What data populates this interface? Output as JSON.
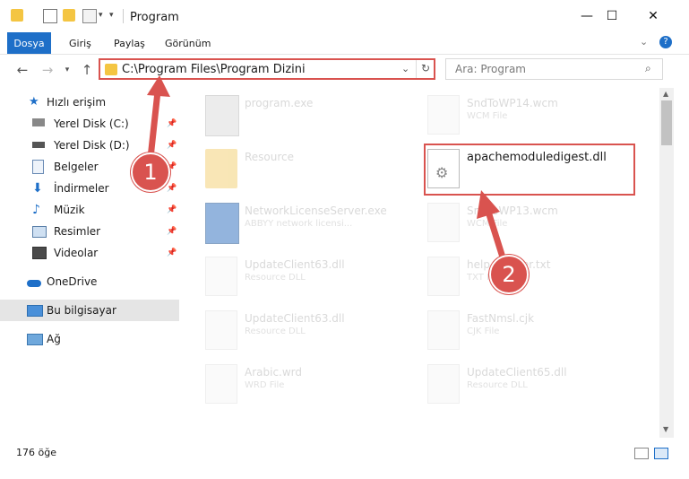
{
  "window": {
    "title": "Program"
  },
  "ribbon": {
    "file_tab": "Dosya",
    "tabs": [
      "Giriş",
      "Paylaş",
      "Görünüm"
    ]
  },
  "nav": {
    "address": "C:\\Program Files\\Program Dizini",
    "search_placeholder": "Ara: Program"
  },
  "sidebar": {
    "items": [
      {
        "label": "Hızlı erişim"
      },
      {
        "label": "Yerel Disk (C:)"
      },
      {
        "label": "Yerel Disk (D:)"
      },
      {
        "label": "Belgeler"
      },
      {
        "label": "İndirmeler"
      },
      {
        "label": "Müzik"
      },
      {
        "label": "Resimler"
      },
      {
        "label": "Videolar"
      },
      {
        "label": "OneDrive"
      },
      {
        "label": "Bu bilgisayar"
      },
      {
        "label": "Ağ"
      }
    ]
  },
  "files": [
    {
      "name": "program.exe",
      "type": ""
    },
    {
      "name": "SndToWP14.wcm",
      "type": "WCM File"
    },
    {
      "name": "Resource",
      "type": ""
    },
    {
      "name": "apachemoduledigest.dll",
      "type": ""
    },
    {
      "name": "NetworkLicenseServer.exe",
      "type": "ABBYY network licensi..."
    },
    {
      "name": "SndToWP13.wcm",
      "type": "WCM File"
    },
    {
      "name": "UpdateClient63.dll",
      "type": "Resource DLL"
    },
    {
      "name": "help_header.txt",
      "type": "TXT File"
    },
    {
      "name": "UpdateClient63.dll",
      "type": "Resource DLL"
    },
    {
      "name": "FastNmsl.cjk",
      "type": "CJK File"
    },
    {
      "name": "Arabic.wrd",
      "type": "WRD File"
    },
    {
      "name": "UpdateClient65.dll",
      "type": "Resource DLL"
    }
  ],
  "status": {
    "count": "176 öğe"
  },
  "annotations": {
    "step1": "1",
    "step2": "2"
  },
  "colors": {
    "accent": "#1e6fc8",
    "highlight": "#d9534f",
    "selected": "#e5e5e5"
  }
}
